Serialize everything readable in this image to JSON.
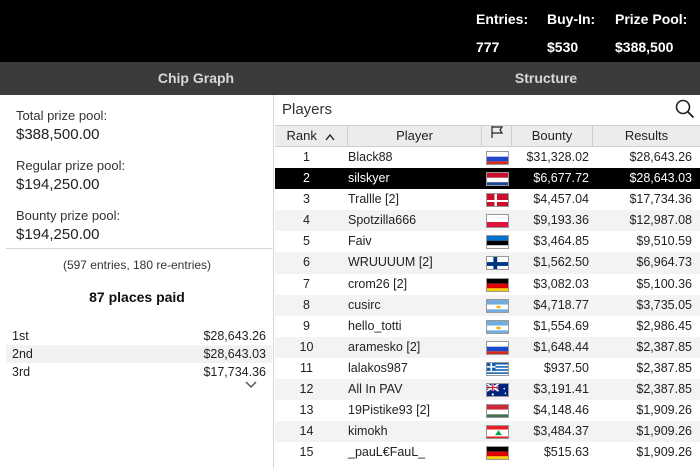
{
  "header": {
    "entries_label": "Entries:",
    "entries_value": "777",
    "buyin_label": "Buy-In:",
    "buyin_value": "$530",
    "prize_pool_label": "Prize Pool:",
    "prize_pool_value": "$388,500"
  },
  "tabs": {
    "chip_graph": "Chip Graph",
    "structure": "Structure"
  },
  "summary": {
    "total_label": "Total prize pool:",
    "total_value": "$388,500.00",
    "regular_label": "Regular prize pool:",
    "regular_value": "$194,250.00",
    "bounty_label": "Bounty prize pool:",
    "bounty_value": "$194,250.00",
    "entries_note": "(597 entries, 180 re-entries)",
    "places_paid": "87 places paid"
  },
  "payouts": [
    {
      "place": "1st",
      "amount": "$28,643.26"
    },
    {
      "place": "2nd",
      "amount": "$28,643.03"
    },
    {
      "place": "3rd",
      "amount": "$17,734.36"
    }
  ],
  "players": {
    "title": "Players",
    "columns": {
      "rank": "Rank",
      "player": "Player",
      "bounty": "Bounty",
      "results": "Results"
    },
    "selected_index": 1,
    "rows": [
      {
        "rank": "1",
        "name": "Black88",
        "flag": "ru",
        "bounty": "$31,328.02",
        "result": "$28,643.26"
      },
      {
        "rank": "2",
        "name": "silskyer",
        "flag": "nl",
        "bounty": "$6,677.72",
        "result": "$28,643.03"
      },
      {
        "rank": "3",
        "name": "Trallle [2]",
        "flag": "dk",
        "bounty": "$4,457.04",
        "result": "$17,734.36"
      },
      {
        "rank": "4",
        "name": "Spotzilla666",
        "flag": "pl",
        "bounty": "$9,193.36",
        "result": "$12,987.08"
      },
      {
        "rank": "5",
        "name": "Faiv",
        "flag": "ee",
        "bounty": "$3,464.85",
        "result": "$9,510.59"
      },
      {
        "rank": "6",
        "name": "WRUUUUM [2]",
        "flag": "fi",
        "bounty": "$1,562.50",
        "result": "$6,964.73"
      },
      {
        "rank": "7",
        "name": "crom26 [2]",
        "flag": "de",
        "bounty": "$3,082.03",
        "result": "$5,100.36"
      },
      {
        "rank": "8",
        "name": "cusirc",
        "flag": "ar",
        "bounty": "$4,718.77",
        "result": "$3,735.05"
      },
      {
        "rank": "9",
        "name": "hello_totti",
        "flag": "ar",
        "bounty": "$1,554.69",
        "result": "$2,986.45"
      },
      {
        "rank": "10",
        "name": "aramesko [2]",
        "flag": "ru",
        "bounty": "$1,648.44",
        "result": "$2,387.85"
      },
      {
        "rank": "11",
        "name": "lalakos987",
        "flag": "gr",
        "bounty": "$937.50",
        "result": "$2,387.85"
      },
      {
        "rank": "12",
        "name": "All In PAV",
        "flag": "au",
        "bounty": "$3,191.41",
        "result": "$2,387.85"
      },
      {
        "rank": "13",
        "name": "19Pistike93 [2]",
        "flag": "hu",
        "bounty": "$4,148.46",
        "result": "$1,909.26"
      },
      {
        "rank": "14",
        "name": "kimokh",
        "flag": "lb",
        "bounty": "$3,484.37",
        "result": "$1,909.26"
      },
      {
        "rank": "15",
        "name": "_pauL€FauL_",
        "flag": "de",
        "bounty": "$515.63",
        "result": "$1,909.26"
      }
    ]
  }
}
